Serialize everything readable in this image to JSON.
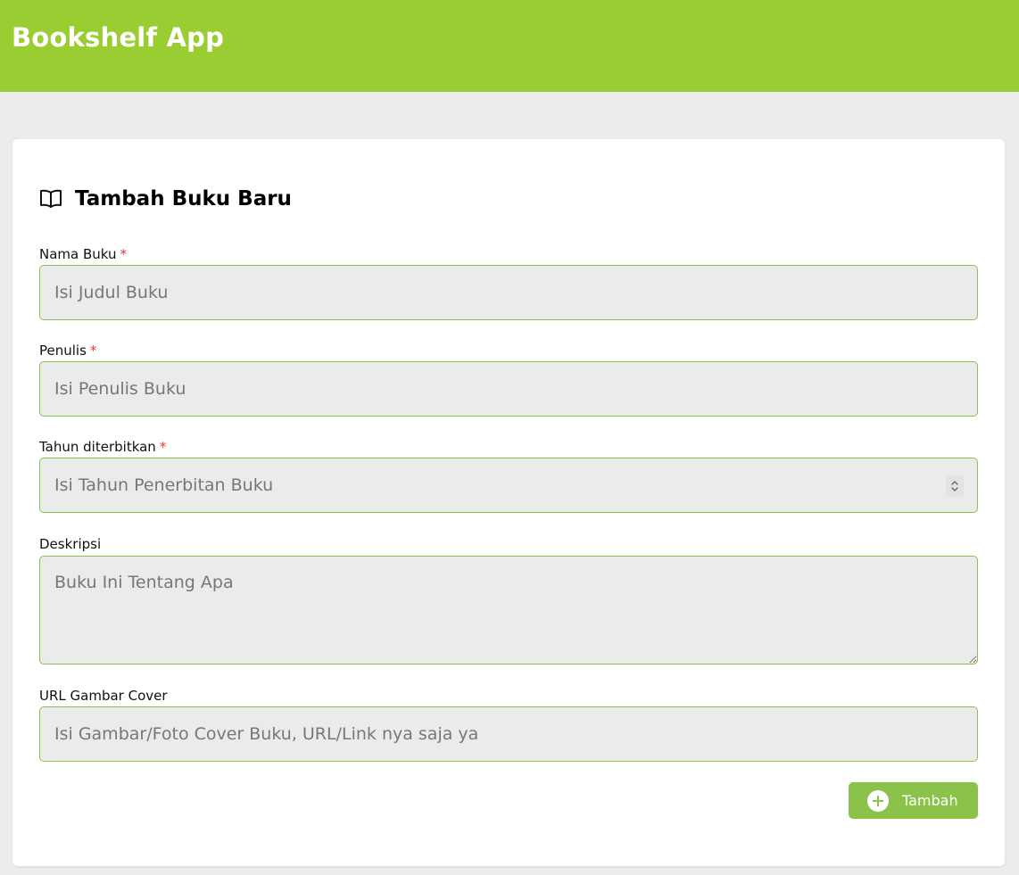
{
  "header": {
    "title": "Bookshelf App",
    "color": "#9acd32"
  },
  "form": {
    "heading": "Tambah Buku Baru",
    "heading_icon": "book-open-icon",
    "required_marker": "*",
    "fields": {
      "title": {
        "label": "Nama Buku",
        "placeholder": "Isi Judul Buku",
        "required": true
      },
      "author": {
        "label": "Penulis",
        "placeholder": "Isi Penulis Buku",
        "required": true
      },
      "year": {
        "label": "Tahun diterbitkan",
        "placeholder": "Isi Tahun Penerbitan Buku",
        "required": true
      },
      "description": {
        "label": "Deskripsi",
        "placeholder": "Buku Ini Tentang Apa",
        "required": false
      },
      "cover_url": {
        "label": "URL Gambar Cover",
        "placeholder": "Isi Gambar/Foto Cover Buku, URL/Link nya saja ya",
        "required": false
      }
    },
    "submit": {
      "label": "Tambah",
      "icon": "plus-circle-icon",
      "color": "#8bc34a"
    }
  }
}
